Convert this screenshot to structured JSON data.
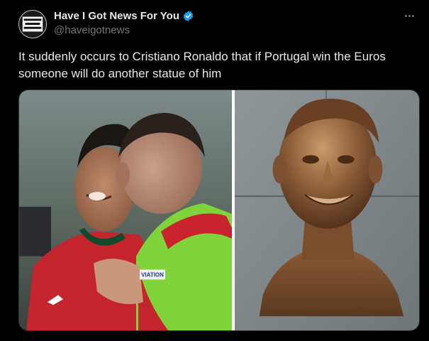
{
  "author": {
    "display_name": "Have I Got News For You",
    "handle": "@haveigotnews",
    "verified_icon": "verified-badge-icon",
    "avatar_text": "HAVE I GOT NEWS FOR YOU"
  },
  "tweet": {
    "text": "It suddenly occurs to Cristiano Ronaldo that if Portugal win the Euros someone will do another statue of him"
  },
  "icons": {
    "more": "more-options-icon"
  },
  "colors": {
    "background": "#000000",
    "text": "#e7e9ea",
    "secondary_text": "#71767b",
    "verified_blue": "#1d9bf0"
  },
  "media": {
    "left_photo": {
      "sleeve_badge_text": "VIATION"
    },
    "right_photo": {}
  }
}
